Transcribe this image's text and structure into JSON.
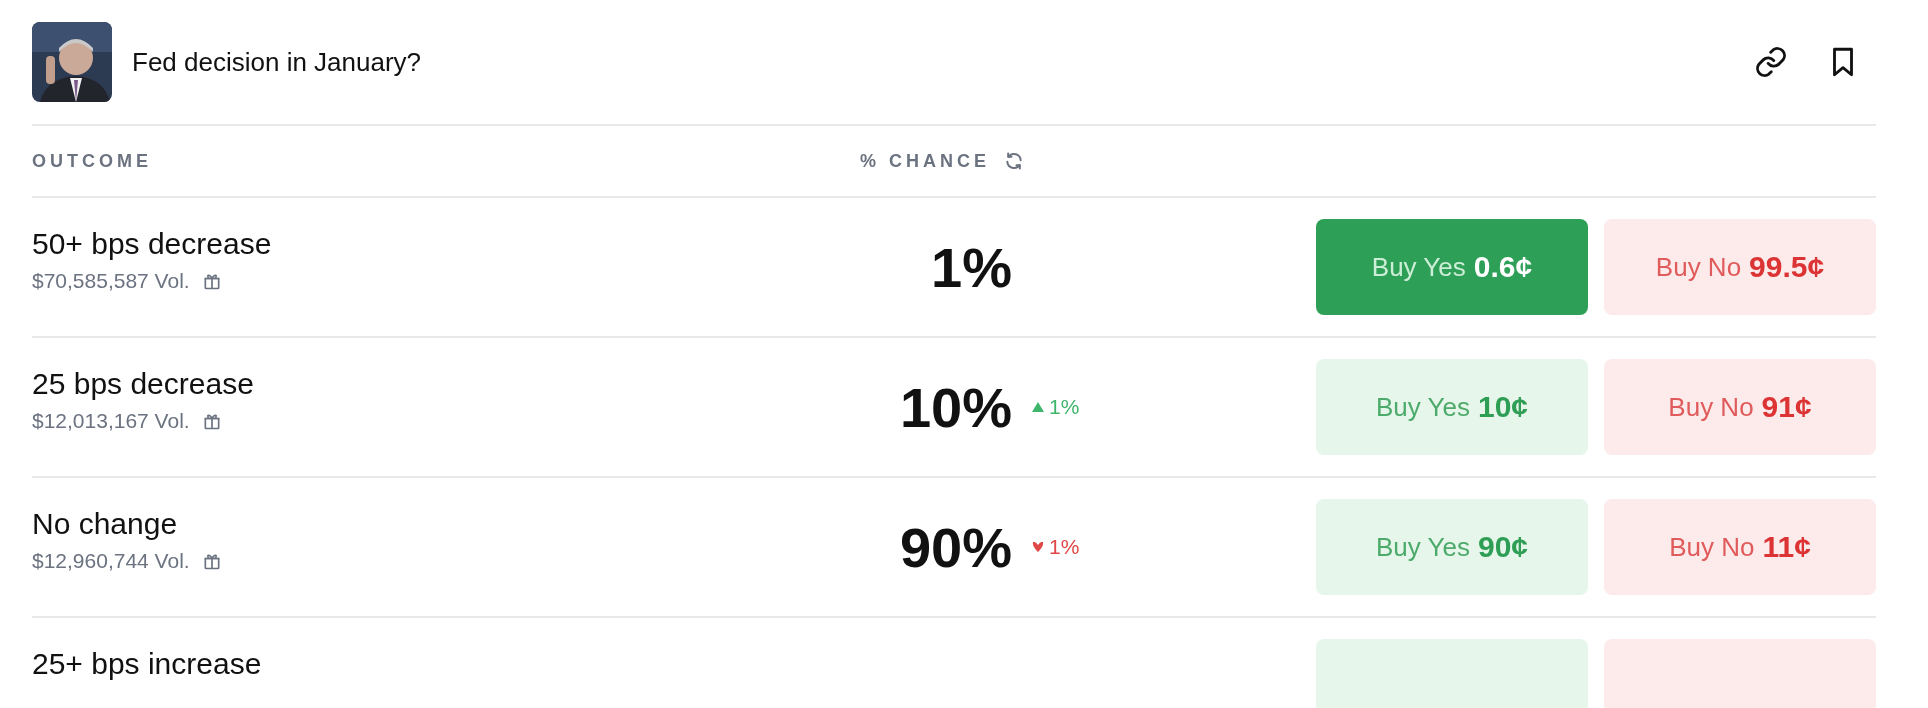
{
  "header": {
    "title": "Fed decision in January?"
  },
  "columns": {
    "outcome": "OUTCOME",
    "chance": "% CHANCE"
  },
  "rows": [
    {
      "label": "50+ bps decrease",
      "volume": "$70,585,587 Vol.",
      "chance": "1%",
      "buy_yes": {
        "label": "Buy Yes",
        "price": "0.6¢",
        "selected": true
      },
      "buy_no": {
        "label": "Buy No",
        "price": "99.5¢",
        "selected": false
      }
    },
    {
      "label": "25 bps decrease",
      "volume": "$12,013,167 Vol.",
      "chance": "10%",
      "change": {
        "kind": "up",
        "text": "1%"
      },
      "buy_yes": {
        "label": "Buy Yes",
        "price": "10¢",
        "selected": false
      },
      "buy_no": {
        "label": "Buy No",
        "price": "91¢",
        "selected": false
      }
    },
    {
      "label": "No change",
      "volume": "$12,960,744 Vol.",
      "chance": "90%",
      "change": {
        "kind": "down",
        "text": "1%"
      },
      "buy_yes": {
        "label": "Buy Yes",
        "price": "90¢",
        "selected": false
      },
      "buy_no": {
        "label": "Buy No",
        "price": "11¢",
        "selected": false
      }
    },
    {
      "label": "25+ bps increase"
    }
  ]
}
